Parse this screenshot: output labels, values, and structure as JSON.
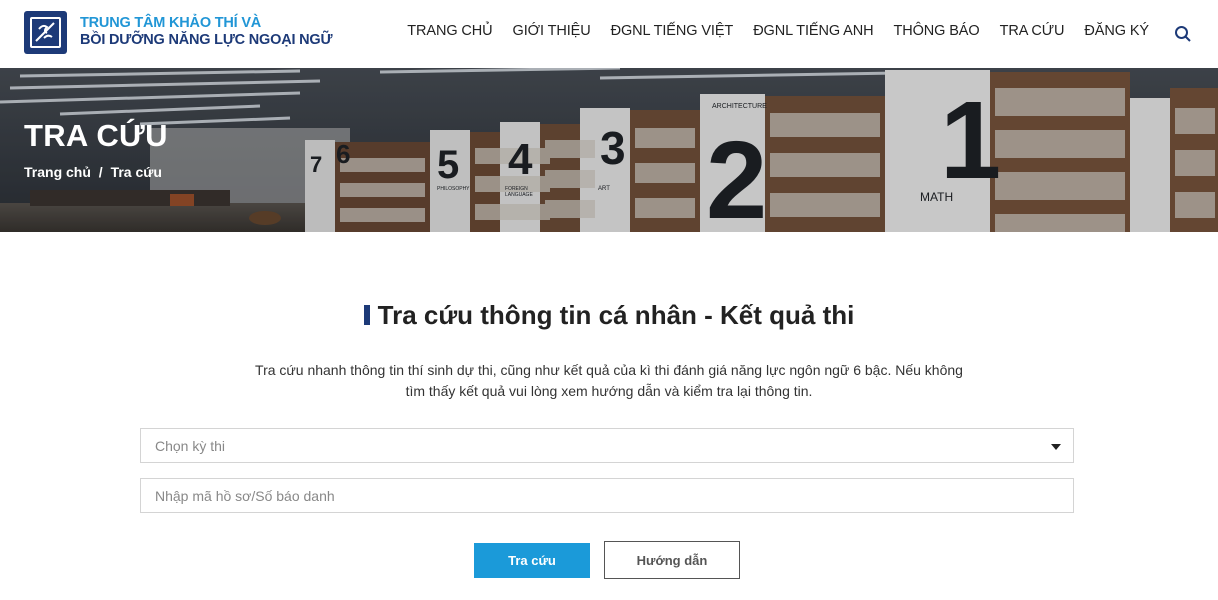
{
  "header": {
    "brand_line1": "TRUNG TÂM KHẢO THÍ VÀ",
    "brand_line2": "BỒI DƯỠNG NĂNG LỰC NGOẠI NGỮ",
    "nav": [
      "TRANG CHỦ",
      "GIỚI THIỆU",
      "ĐGNL TIẾNG VIỆT",
      "ĐGNL TIẾNG ANH",
      "THÔNG BÁO",
      "TRA CỨU",
      "ĐĂNG KÝ"
    ],
    "search_icon": "search-icon"
  },
  "banner": {
    "title": "TRA CỨU",
    "breadcrumb_home": "Trang chủ",
    "breadcrumb_sep": "/",
    "breadcrumb_current": "Tra cứu",
    "shelf_labels": [
      "1",
      "2",
      "3",
      "4",
      "5",
      "6",
      "7",
      "MATH",
      "ARCHITECTURE",
      "ART",
      "FOREIGN LANGUAGE",
      "PHILOSOPHY"
    ]
  },
  "main": {
    "title": "Tra cứu thông tin cá nhân - Kết quả thi",
    "description_line1": "Tra cứu nhanh thông tin thí sinh dự thi, cũng như kết quả của kì thi đánh giá năng lực ngôn ngữ 6 bậc. Nếu không",
    "description_line2": "tìm thấy kết quả vui lòng xem hướng dẫn và kiểm tra lại thông tin.",
    "select_placeholder": "Chọn kỳ thi",
    "input_placeholder": "Nhập mã hồ sơ/Số báo danh",
    "search_button": "Tra cứu",
    "guide_button": "Hướng dẫn"
  },
  "colors": {
    "brand_blue": "#2196d6",
    "brand_navy": "#1d3a78",
    "button_blue": "#1b9ad9"
  }
}
